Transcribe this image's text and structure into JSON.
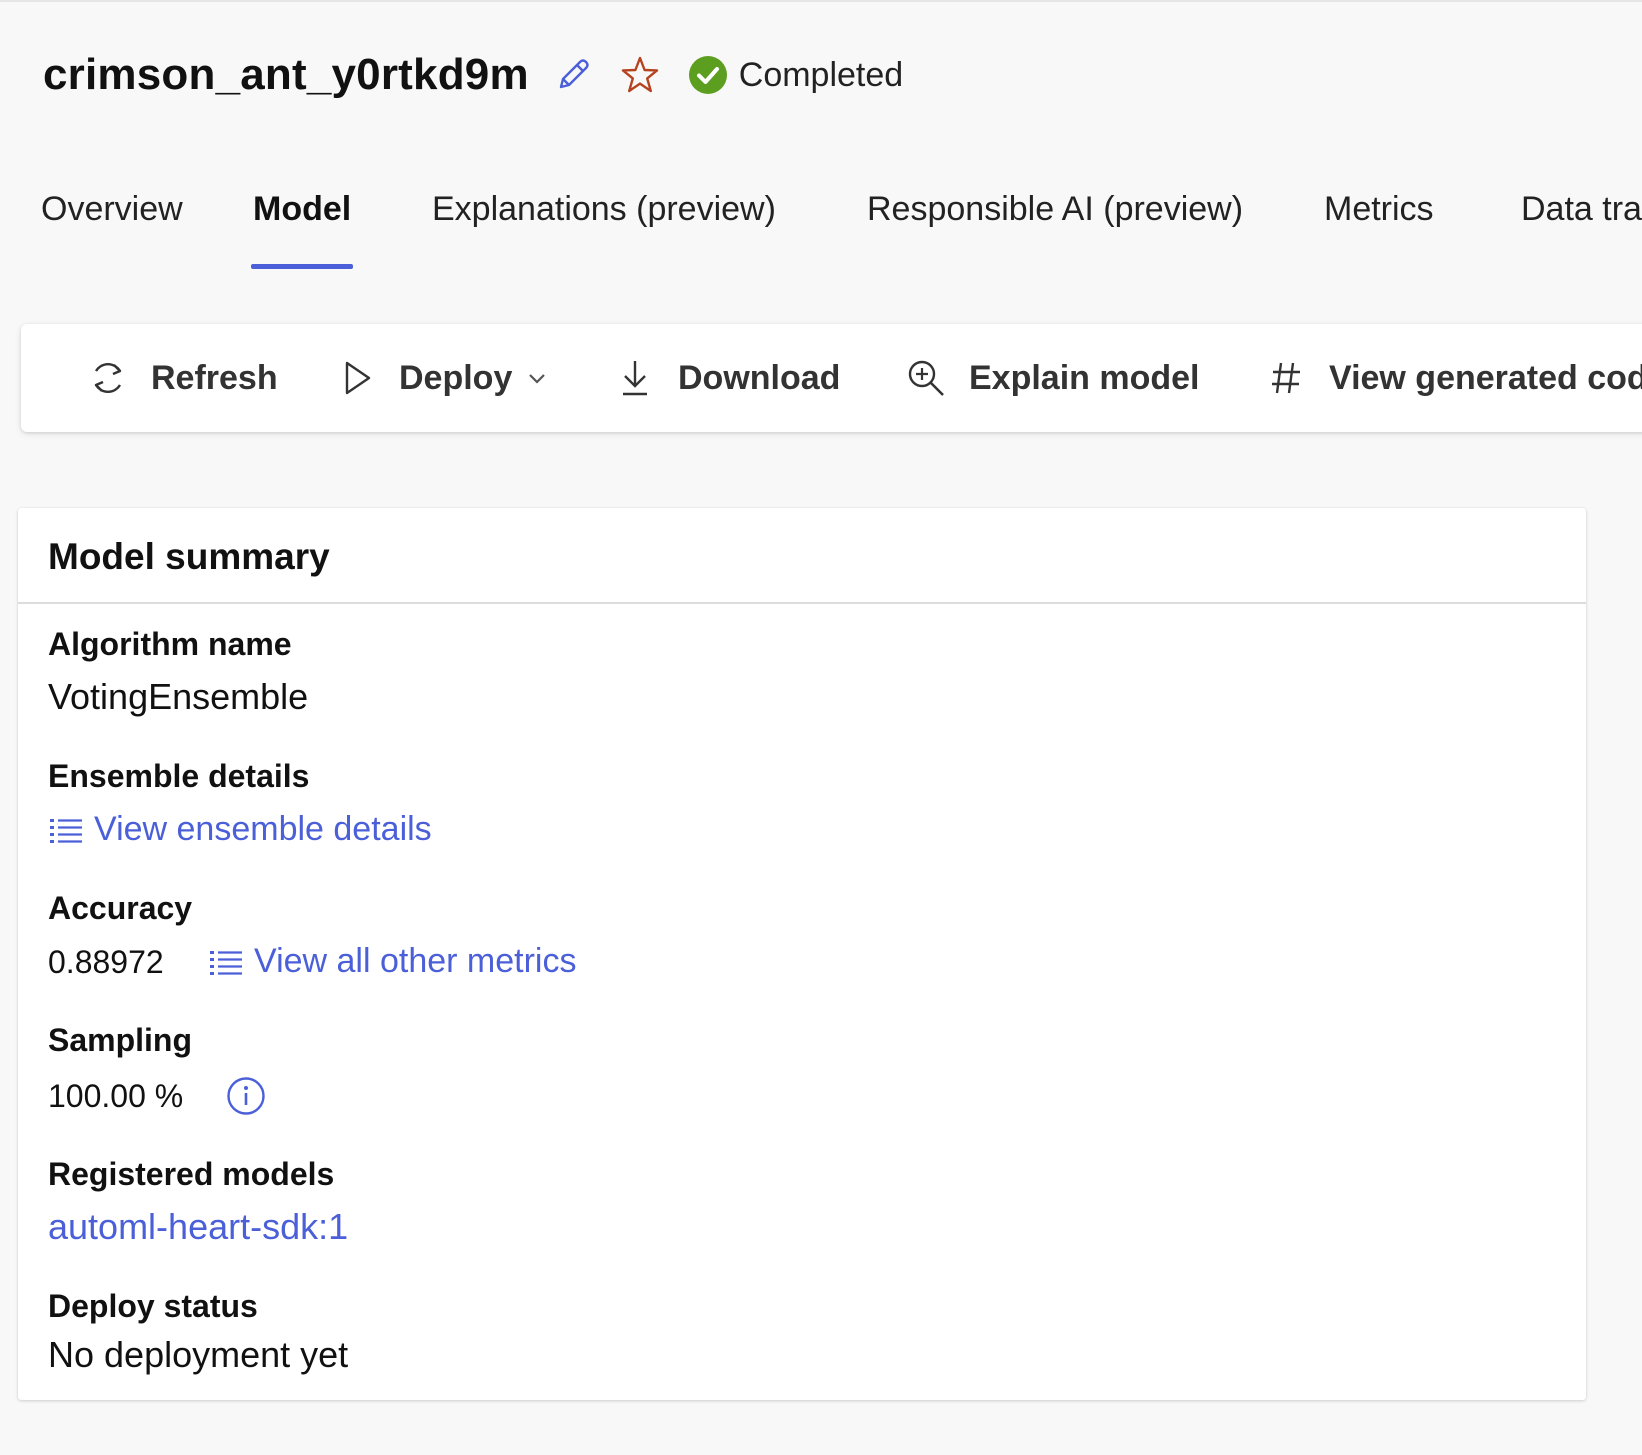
{
  "header": {
    "run_name": "crimson_ant_y0rtkd9m",
    "status": "Completed",
    "status_color": "#5c9e1f"
  },
  "tabs": [
    {
      "label": "Overview",
      "active": false
    },
    {
      "label": "Model",
      "active": true
    },
    {
      "label": "Explanations (preview)",
      "active": false
    },
    {
      "label": "Responsible AI (preview)",
      "active": false
    },
    {
      "label": "Metrics",
      "active": false
    },
    {
      "label": "Data tra",
      "active": false
    }
  ],
  "toolbar": {
    "refresh": {
      "label": "Refresh",
      "icon": "refresh-icon"
    },
    "deploy": {
      "label": "Deploy",
      "icon": "play-icon"
    },
    "download": {
      "label": "Download",
      "icon": "download-icon"
    },
    "explain": {
      "label": "Explain model",
      "icon": "zoom-in-icon"
    },
    "code": {
      "label": "View generated code",
      "icon": "hash-icon"
    }
  },
  "summary": {
    "title": "Model summary",
    "algorithm_label": "Algorithm name",
    "algorithm_value": "VotingEnsemble",
    "ensemble_label": "Ensemble details",
    "ensemble_link": "View ensemble details",
    "accuracy_label": "Accuracy",
    "accuracy_value": "0.88972",
    "metrics_link": "View all other metrics",
    "sampling_label": "Sampling",
    "sampling_value": "100.00 %",
    "registered_label": "Registered models",
    "registered_value": "automl-heart-sdk:1",
    "deploy_label": "Deploy status",
    "deploy_value": "No deployment yet"
  },
  "colors": {
    "accent": "#4b5fd8",
    "star": "#b5431f",
    "background": "#f8f8f8"
  }
}
